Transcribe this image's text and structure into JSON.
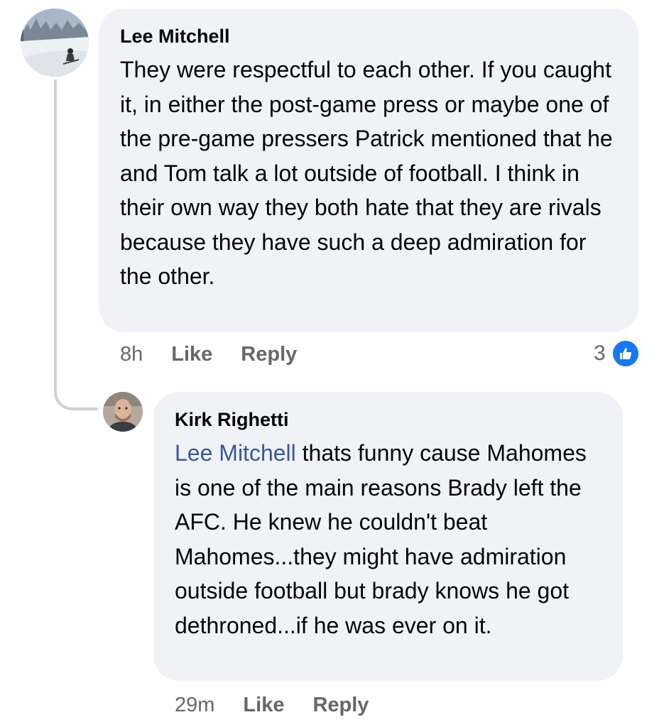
{
  "comments": [
    {
      "author": "Lee Mitchell",
      "text": "They were respectful to each other. If you caught it, in either the post-game press or maybe one of the pre-game pressers Patrick mentioned that he and Tom talk a lot outside of football. I think in their own way they both hate that they are rivals because they have such a deep admiration for the other.",
      "time": "8h",
      "like_label": "Like",
      "reply_label": "Reply",
      "reaction_count": "3",
      "reaction_icon": "thumbs-up-icon",
      "avatar": "ski-avatar"
    },
    {
      "author": "Kirk Righetti",
      "mention": "Lee Mitchell",
      "text": " thats funny cause Mahomes is one of the main reasons Brady left the AFC.  He knew he couldn't beat Mahomes...they might have admiration outside football but brady knows he got dethroned...if he was ever on it.",
      "time": "29m",
      "like_label": "Like",
      "reply_label": "Reply",
      "avatar": "person-avatar"
    }
  ],
  "colors": {
    "bubble": "#f0f2f5",
    "mention": "#385898",
    "meta": "#65676b",
    "like_badge": "#1877f2",
    "thread_line": "#ced0d4"
  }
}
